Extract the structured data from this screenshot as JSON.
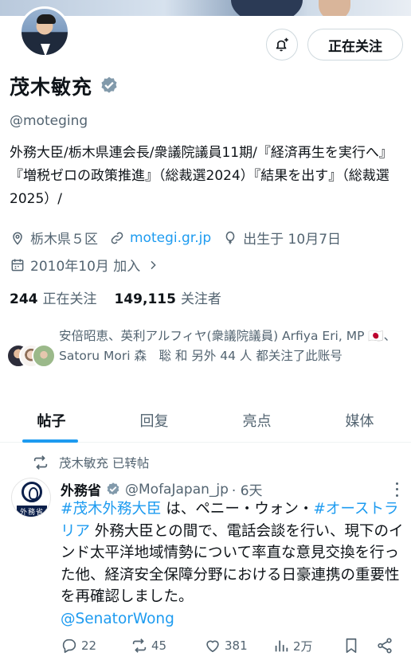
{
  "profile": {
    "name": "茂木敏充",
    "handle": "@moteging",
    "follow_button": "正在关注",
    "bio_segments": [
      "外務大臣/栃木県連会長/衆議院議員11期/『経済再生を実行へ』『増税ゼロの政策推進』（総裁選2024）『結果を出す』（総裁選2025）/"
    ],
    "location": "栃木県５区",
    "website": "motegi.gr.jp",
    "birthday": "出生于 10月7日",
    "joined": "2010年10月 加入",
    "following_count": "244",
    "following_label": "正在关注",
    "followers_count": "149,115",
    "followers_label": "关注者",
    "followed_by": "安倍昭恵、英利アルフィヤ(衆議院議員) Arfiya Eri, MP 🇯🇵、Satoru Mori 森　聡 和 另外 44 人 都关注了此账号"
  },
  "tabs": [
    {
      "label": "帖子",
      "active": true
    },
    {
      "label": "回复",
      "active": false
    },
    {
      "label": "亮点",
      "active": false
    },
    {
      "label": "媒体",
      "active": false
    }
  ],
  "post": {
    "repost_label": "茂木敏充 已转帖",
    "author_name": "外務省",
    "author_handle": "@MofaJapan_jp",
    "time": "· 6天",
    "avatar_plate": "外務省",
    "text_parts": [
      {
        "text": "#茂木外務大臣",
        "tag": true
      },
      {
        "text": " は、ペニー・ウォン・",
        "tag": false
      },
      {
        "text": "#オーストラリア",
        "tag": true
      },
      {
        "text": " 外務大臣との間で、電話会談を行い、現下のインド太平洋地域情勢について率直な意見交換を行った他、経済安全保障分野における日豪連携の重要性を再確認しました。",
        "tag": false
      },
      {
        "text": "@SenatorWong",
        "tag": true
      }
    ],
    "stats": {
      "replies": "22",
      "reposts": "45",
      "likes": "381",
      "views": "2万"
    }
  },
  "colors": {
    "accent": "#1d9bf0",
    "text": "#0f1419",
    "muted": "#536471",
    "verified": "#829aab"
  }
}
